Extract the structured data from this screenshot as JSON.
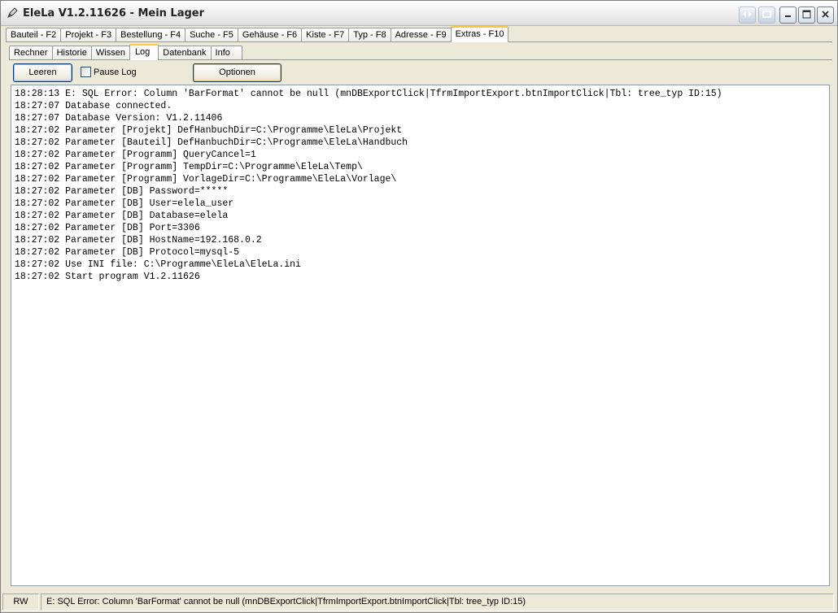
{
  "window": {
    "title": "EleLa V1.2.11626  - Mein Lager",
    "app_icon": "pen-tool-icon"
  },
  "titlebar_buttons": [
    {
      "icon": "nav-arrows-icon"
    },
    {
      "icon": "restore-small-icon"
    },
    {
      "icon": "minimize-icon"
    },
    {
      "icon": "maximize-icon"
    },
    {
      "icon": "close-icon"
    }
  ],
  "main_tabs": [
    {
      "label": "Bauteil - F2"
    },
    {
      "label": "Projekt - F3"
    },
    {
      "label": "Bestellung - F4"
    },
    {
      "label": "Suche - F5"
    },
    {
      "label": "Gehäuse - F6"
    },
    {
      "label": "Kiste - F7"
    },
    {
      "label": "Typ - F8"
    },
    {
      "label": "Adresse - F9"
    },
    {
      "label": "Extras - F10",
      "active": true
    }
  ],
  "sub_tabs": [
    {
      "label": "Rechner"
    },
    {
      "label": "Historie"
    },
    {
      "label": "Wissen"
    },
    {
      "label": "Log",
      "active": true
    },
    {
      "label": "Datenbank"
    },
    {
      "label": "Info"
    }
  ],
  "toolbar": {
    "leeren_label": "Leeren",
    "pause_log_label": "Pause Log",
    "pause_log_checked": false,
    "optionen_label": "Optionen"
  },
  "log_lines": [
    "18:28:13 E: SQL Error: Column 'BarFormat' cannot be null (mnDBExportClick|TfrmImportExport.btnImportClick|Tbl: tree_typ ID:15)",
    "18:27:07 Database connected.",
    "18:27:07 Database Version: V1.2.11406",
    "18:27:02 Parameter [Projekt] DefHanbuchDir=C:\\Programme\\EleLa\\Projekt",
    "18:27:02 Parameter [Bauteil] DefHanbuchDir=C:\\Programme\\EleLa\\Handbuch",
    "18:27:02 Parameter [Programm] QueryCancel=1",
    "18:27:02 Parameter [Programm] TempDir=C:\\Programme\\EleLa\\Temp\\",
    "18:27:02 Parameter [Programm] VorlageDir=C:\\Programme\\EleLa\\Vorlage\\",
    "18:27:02 Parameter [DB] Password=*****",
    "18:27:02 Parameter [DB] User=elela_user",
    "18:27:02 Parameter [DB] Database=elela",
    "18:27:02 Parameter [DB] Port=3306",
    "18:27:02 Parameter [DB] HostName=192.168.0.2",
    "18:27:02 Parameter [DB] Protocol=mysql-5",
    "18:27:02 Use INI file: C:\\Programme\\EleLa\\EleLa.ini",
    "18:27:02 Start program V1.2.11626"
  ],
  "statusbar": {
    "mode": "RW",
    "message": "E: SQL Error: Column 'BarFormat' cannot be null (mnDBExportClick|TfrmImportExport.btnImportClick|Tbl: tree_typ ID:15)"
  },
  "colors": {
    "active_tab_accent": "#ffc83c",
    "button_border": "#003c74",
    "log_border": "#7f9db9"
  }
}
